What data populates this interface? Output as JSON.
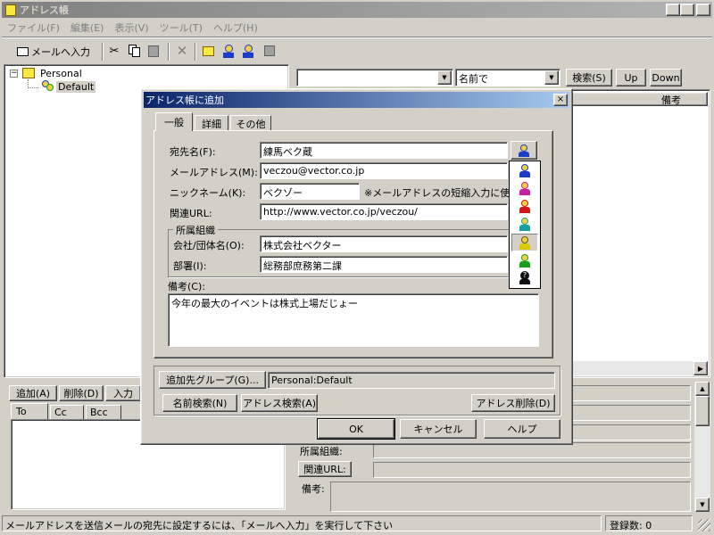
{
  "window": {
    "title": "アドレス帳"
  },
  "menu": [
    "ファイル(F)",
    "編集(E)",
    "表示(V)",
    "ツール(T)",
    "ヘルプ(H)"
  ],
  "toolbar": {
    "mail_input_label": "メールへ入力"
  },
  "tree": {
    "root": "Personal",
    "child": "Default"
  },
  "search": {
    "field_value": "",
    "mode_value": "名前で",
    "search_button": "検索(S)",
    "up_button": "Up",
    "down_button": "Down"
  },
  "list": {
    "header_note": "備考"
  },
  "recipients": {
    "add_button": "追加(A)",
    "delete_button": "削除(D)",
    "input_button": "入力",
    "tabs": [
      "To",
      "Cc",
      "Bcc"
    ]
  },
  "details": {
    "org_label": "所属組織:",
    "url_label": "関連URL:",
    "note_label": "備考:"
  },
  "status": {
    "message": "メールアドレスを送信メールの宛先に設定するには、「メールへ入力」を実行して下さい",
    "count": "登録数: 0"
  },
  "dialog": {
    "title": "アドレス帳に追加",
    "tabs": [
      "一般",
      "詳細",
      "その他"
    ],
    "name_label": "宛先名(F):",
    "name_value": "練馬ベク蔵",
    "email_label": "メールアドレス(M):",
    "email_value": "veczou@vector.co.jp",
    "nickname_label": "ニックネーム(K):",
    "nickname_value": "ベクゾー",
    "nickname_hint": "※メールアドレスの短縮入力に使",
    "url_label": "関連URL:",
    "url_value": "http://www.vector.co.jp/veczou/",
    "org_group": "所属組織",
    "company_label": "会社/団体名(O):",
    "company_value": "株式会社ベクター",
    "dept_label": "部署(I):",
    "dept_value": "総務部庶務第二課",
    "note_label": "備考(C):",
    "note_value": "今年の最大のイベントは株式上場だじょー",
    "group_button": "追加先グループ(G)...",
    "group_value": "Personal:Default",
    "name_search_button": "名前検索(N)",
    "address_search_button": "アドレス検索(A)",
    "address_delete_button": "アドレス削除(D)",
    "ok_button": "OK",
    "cancel_button": "キャンセル",
    "help_button": "ヘルプ"
  },
  "icon_colors": {
    "blue": "#1a3cc8",
    "magenta": "#c81ea0",
    "red": "#d01818",
    "cyan": "#18a0a0",
    "yellow": "#d8c800",
    "green": "#18a018",
    "black": "#101010",
    "skin": "#f0d040"
  }
}
